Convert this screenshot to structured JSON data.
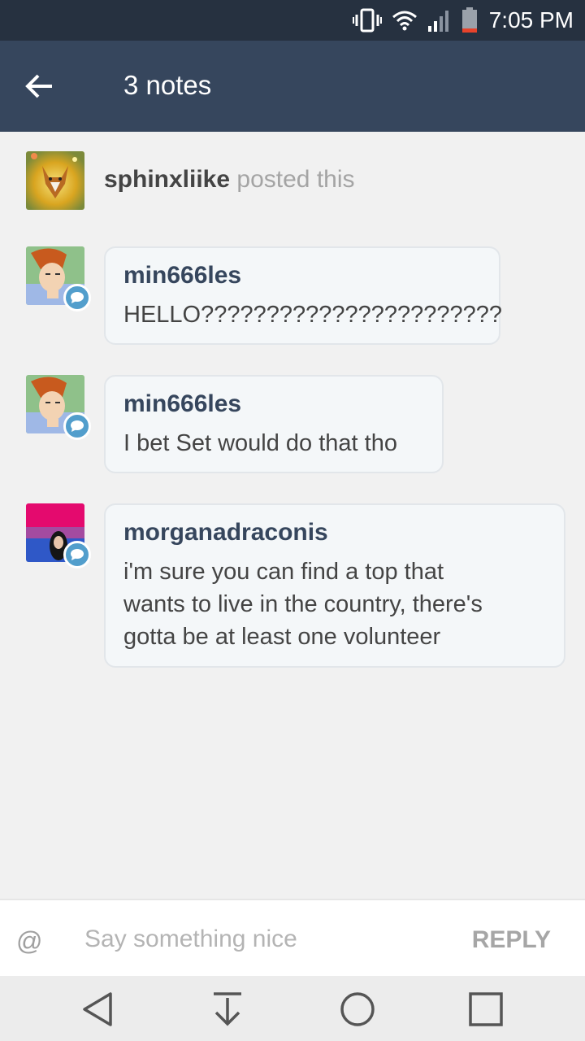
{
  "status_bar": {
    "time": "7:05 PM",
    "icons": [
      "vibrate-icon",
      "wifi-icon",
      "signal-icon",
      "battery-icon"
    ]
  },
  "header": {
    "title": "3 notes",
    "back_icon": "back-arrow-icon"
  },
  "notes": [
    {
      "type": "post",
      "user": "sphinxliike",
      "action": "posted this"
    },
    {
      "type": "reply",
      "user": "min666les",
      "text": "HELLO???????????????????????"
    },
    {
      "type": "reply",
      "user": "min666les",
      "text": "I bet Set would do that tho"
    },
    {
      "type": "reply",
      "user": "morganadraconis",
      "text": "i'm sure you can find a top that\nwants to live in the country, there's\ngotta be at least one volunteer"
    }
  ],
  "reply_bar": {
    "at_symbol": "@",
    "placeholder": "Say something nice",
    "value": "",
    "button_label": "REPLY"
  },
  "nav_bar": {
    "buttons": [
      "back-triangle-icon",
      "download-icon",
      "home-circle-icon",
      "recents-square-icon"
    ]
  },
  "colors": {
    "status_bar": "#263140",
    "header": "#36465d",
    "username": "#36465d",
    "badge": "#529ecc"
  }
}
